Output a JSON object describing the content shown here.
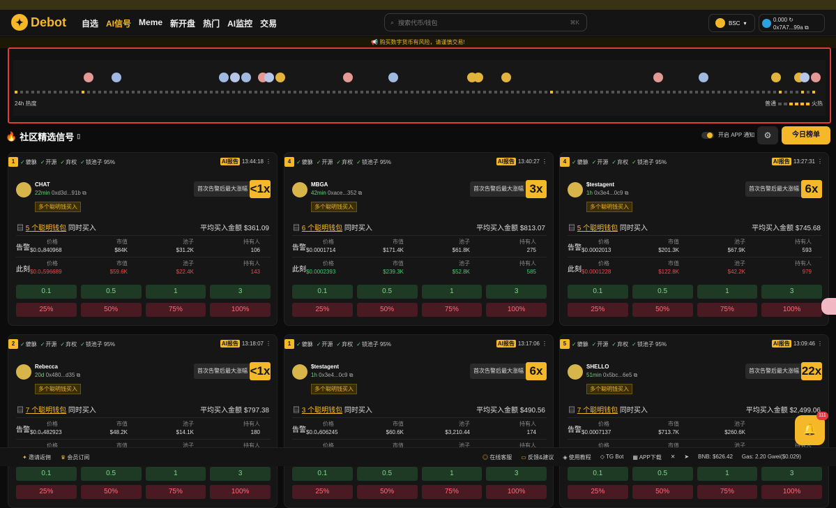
{
  "brand": {
    "name": "Debot",
    "logo": "bird-logo",
    "accent": "#f4b828"
  },
  "nav": [
    "自选",
    "AI信号",
    "Meme",
    "新开盘",
    "热门",
    "AI监控",
    "交易"
  ],
  "nav_active": "AI信号",
  "search": {
    "placeholder": "搜索代币/钱包",
    "shortcut": "⌘K"
  },
  "chain": {
    "label": "BSC"
  },
  "wallet": {
    "balance": "0.000",
    "address": "0x7A7...99a"
  },
  "notice": "📢 购买数字货币有风险，请谨慎交易!",
  "heatmap": {
    "label": "24h 热度",
    "legend_low": "普通",
    "legend_high": "火热"
  },
  "section": {
    "title": "社区精选信号",
    "notify_label": "开启 APP 通知",
    "today_button": "今日榜单"
  },
  "labels": {
    "alert_max": "首次告警后最大涨幅",
    "smart_tag": "多个聪明钱买入",
    "smart_suffix": "个聪明钱包",
    "buy_suffix": "同时买入",
    "avg_prefix": "平均买入金额",
    "row_alert": "告警",
    "row_now": "此刻",
    "col_price": "价格",
    "col_mcap": "市值",
    "col_pool": "池子",
    "col_holders": "持有人",
    "check_1": "貔貅",
    "check_2": "开源",
    "check_3": "弃权",
    "check_4": "锁池子 95%",
    "ai_tag": "AI报告"
  },
  "buy_amounts": [
    "0.1",
    "0.5",
    "1",
    "3"
  ],
  "sell_percents": [
    "25%",
    "50%",
    "75%",
    "100%"
  ],
  "cards": [
    {
      "rank": "1",
      "time": "13:44:18",
      "name": "CHAT",
      "age": "22min",
      "addr": "0xd3d...91b",
      "multiplier": "<1x",
      "smart_count": "5",
      "avg": "$361.09",
      "alert": {
        "price": "$0.0₄840968",
        "mcap": "$84K",
        "pool": "$31.2K",
        "holders": "106"
      },
      "now": {
        "price": "$0.0₄596689",
        "mcap": "$59.6K",
        "pool": "$22.4K",
        "holders": "143"
      },
      "now_trend": "r"
    },
    {
      "rank": "4",
      "time": "13:40:27",
      "name": "MBGA",
      "age": "42min",
      "addr": "0xace...352",
      "multiplier": "3x",
      "smart_count": "6",
      "avg": "$813.07",
      "alert": {
        "price": "$0.0001714",
        "mcap": "$171.4K",
        "pool": "$61.8K",
        "holders": "275"
      },
      "now": {
        "price": "$0.0002393",
        "mcap": "$239.3K",
        "pool": "$52.8K",
        "holders": "585"
      },
      "now_trend": "g"
    },
    {
      "rank": "4",
      "time": "13:27:31",
      "name": "$testagent",
      "age": "1h",
      "addr": "0x3e4...0c9",
      "multiplier": "6x",
      "smart_count": "5",
      "avg": "$745.68",
      "alert": {
        "price": "$0.0002013",
        "mcap": "$201.3K",
        "pool": "$67.9K",
        "holders": "593"
      },
      "now": {
        "price": "$0.0001228",
        "mcap": "$122.8K",
        "pool": "$42.2K",
        "holders": "979"
      },
      "now_trend": "r"
    },
    {
      "rank": "2",
      "time": "13:18:07",
      "name": "Rebecca",
      "age": "20d",
      "addr": "0x480...d35",
      "multiplier": "<1x",
      "smart_count": "7",
      "avg": "$797.38",
      "alert": {
        "price": "$0.0₄482923",
        "mcap": "$48.2K",
        "pool": "$14.1K",
        "holders": "180"
      },
      "now": {
        "price": "",
        "mcap": "",
        "pool": "",
        "holders": ""
      },
      "now_trend": "r"
    },
    {
      "rank": "1",
      "time": "13:17:06",
      "name": "$testagent",
      "age": "1h",
      "addr": "0x3e4...0c9",
      "multiplier": "6x",
      "smart_count": "3",
      "avg": "$490.56",
      "alert": {
        "price": "$0.0₄606245",
        "mcap": "$60.6K",
        "pool": "$3,210.44",
        "holders": "174"
      },
      "now": {
        "price": "",
        "mcap": "",
        "pool": "",
        "holders": ""
      },
      "now_trend": "g"
    },
    {
      "rank": "5",
      "time": "13:09:46",
      "name": "SHELLO",
      "age": "51min",
      "addr": "0x5bc...6e5",
      "multiplier": "22x",
      "smart_count": "7",
      "avg": "$2,499.06",
      "alert": {
        "price": "$0.0007137",
        "mcap": "$713.7K",
        "pool": "$260.6K",
        "holders": "1,303"
      },
      "now": {
        "price": "",
        "mcap": "",
        "pool": "",
        "holders": ""
      },
      "now_trend": "g"
    }
  ],
  "footer": {
    "invite": "邀请返佣",
    "member": "会员订阅",
    "support": "在线客服",
    "feedback": "反馈&建议",
    "tutorial": "使用教程",
    "tg_bot": "TG Bot",
    "app": "APP下载",
    "bnb": "BNB: $626.42",
    "gas": "Gas: 2.20 Gwei($0.029)"
  },
  "float_badge": "111"
}
